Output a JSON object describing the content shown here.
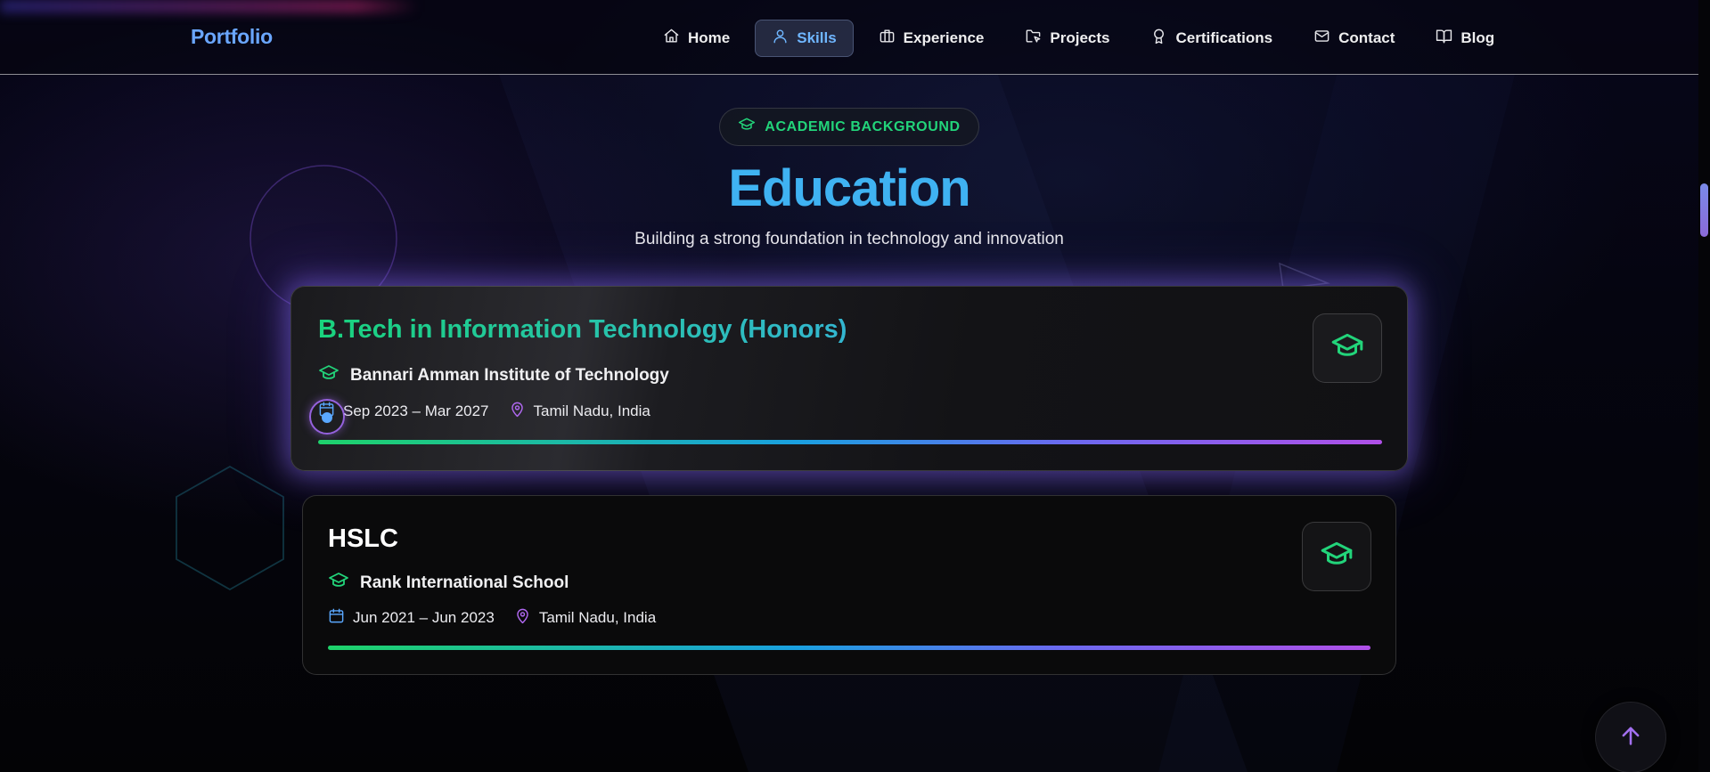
{
  "nav": {
    "brand": "Portfolio",
    "items": [
      {
        "label": "Home",
        "icon": "home-icon"
      },
      {
        "label": "Skills",
        "icon": "user-icon",
        "active": true
      },
      {
        "label": "Experience",
        "icon": "briefcase-icon"
      },
      {
        "label": "Projects",
        "icon": "folder-cursor-icon"
      },
      {
        "label": "Certifications",
        "icon": "award-icon"
      },
      {
        "label": "Contact",
        "icon": "mail-icon"
      },
      {
        "label": "Blog",
        "icon": "book-icon"
      }
    ]
  },
  "section": {
    "badge": "ACADEMIC BACKGROUND",
    "title": "Education",
    "subtitle": "Building a strong foundation in technology and innovation"
  },
  "education": [
    {
      "degree": "B.Tech in Information Technology (Honors)",
      "institution": "Bannari Amman Institute of Technology",
      "period": "Sep 2023 – Mar 2027",
      "location": "Tamil Nadu, India"
    },
    {
      "degree": "HSLC",
      "institution": "Rank International School",
      "period": "Jun 2021 – Jun 2023",
      "location": "Tamil Nadu, India"
    }
  ],
  "colors": {
    "accent_green": "#22d47a",
    "accent_blue": "#3fb2f2",
    "accent_purple": "#b068f0"
  }
}
